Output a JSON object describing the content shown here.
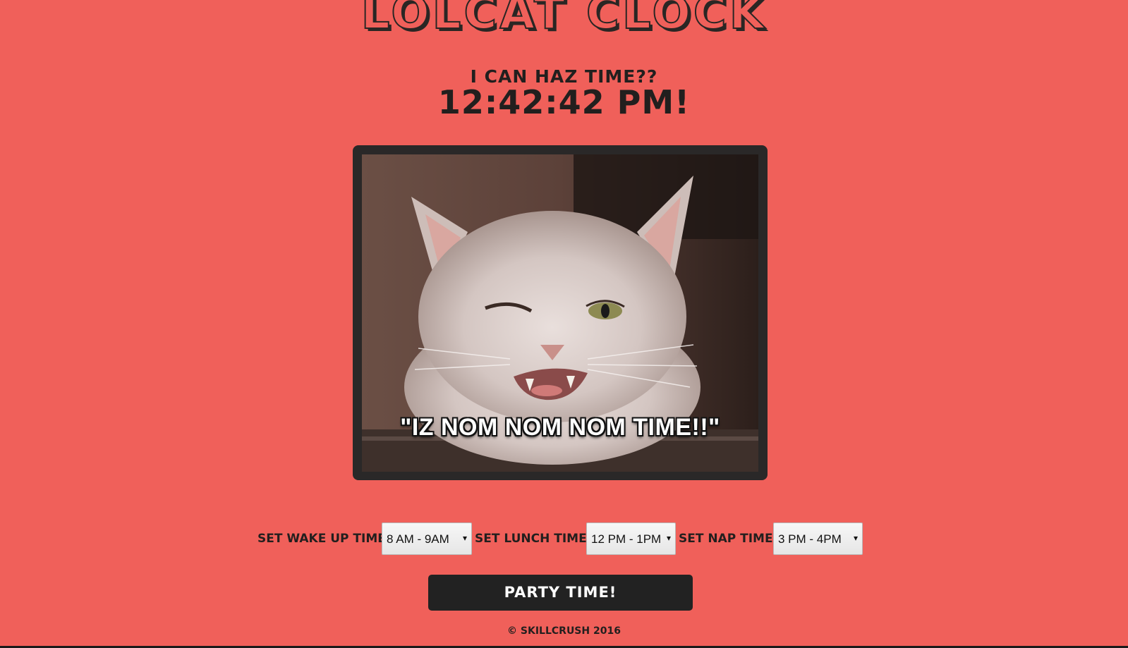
{
  "header": {
    "title": "LOLCAT CLOCK",
    "subtitle": "I CAN HAZ TIME??",
    "clock_text": "12:42:42 PM!"
  },
  "photo": {
    "caption": "\"IZ NOM NOM NOM TIME!!\""
  },
  "controls": {
    "wake_label": "Set Wake Up Time",
    "wake_value": "8 AM - 9AM",
    "lunch_label": "Set Lunch Time",
    "lunch_value": "12 PM - 1PM",
    "nap_label": "Set Nap Time",
    "nap_value": "3 PM - 4PM",
    "dropdown_arrow": "▾"
  },
  "party_button": {
    "label": "PARTY TIME!"
  },
  "footer": {
    "text": "© SKILLCRUSH 2016"
  },
  "colors": {
    "background": "#f0605a",
    "dark": "#222222",
    "frame": "#2a2828"
  }
}
